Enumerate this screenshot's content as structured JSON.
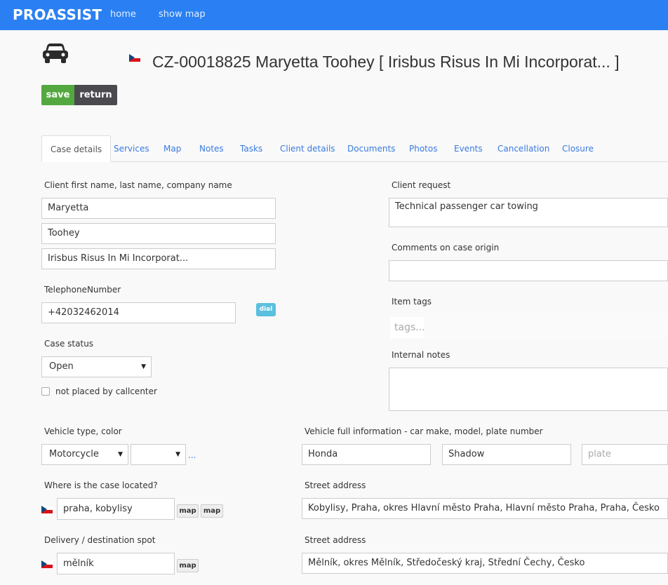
{
  "navbar": {
    "brand": "PROASSIST",
    "links": [
      "home",
      "show map"
    ]
  },
  "header": {
    "title": "CZ-00018825 Maryetta Toohey [ Irisbus Risus In Mi Incorporat... ]",
    "icon": "car-icon",
    "flag": "czech-flag-icon"
  },
  "actions": {
    "save_label": "save",
    "return_label": "return"
  },
  "tabs": [
    "Case details",
    "Services",
    "Map",
    "Notes",
    "Tasks",
    "Client details",
    "Documents",
    "Photos",
    "Events",
    "Cancellation",
    "Closure"
  ],
  "client": {
    "name_label": "Client first name, last name, company name",
    "first_name": "Maryetta",
    "last_name": "Toohey",
    "company": "Irisbus Risus In Mi Incorporat...",
    "phone_label": "TelephoneNumber",
    "phone": "+42032462014",
    "dial_label": "dial"
  },
  "case_status": {
    "label": "Case status",
    "value": "Open",
    "checkbox_label": "not placed by callcenter"
  },
  "right_panel": {
    "request_label": "Client request",
    "request_value": "Technical passenger car towing",
    "comments_label": "Comments on case origin",
    "comments_value": "",
    "tags_label": "Item tags",
    "tags_placeholder": "tags...",
    "internal_label": "Internal notes",
    "internal_value": ""
  },
  "vehicle": {
    "type_label": "Vehicle type, color",
    "type_value": "Motorcycle",
    "color_value": "",
    "more": "...",
    "full_label": "Vehicle full information - car make, model, plate number",
    "make": "Honda",
    "model": "Shadow",
    "plate_placeholder": "plate"
  },
  "location": {
    "label": "Where is the case located?",
    "value": "praha, kobylisy",
    "map1": "map",
    "map2": "map",
    "street_label": "Street address",
    "street_value": "Kobylisy, Praha, okres Hlavní město Praha, Hlavní město Praha, Praha, Česko"
  },
  "destination": {
    "label": "Delivery / destination spot",
    "value": "mělník",
    "map": "map",
    "street_label": "Street address",
    "street_value": "Mělník, okres Mělník, Středočeský kraj, Střední Čechy, Česko"
  }
}
